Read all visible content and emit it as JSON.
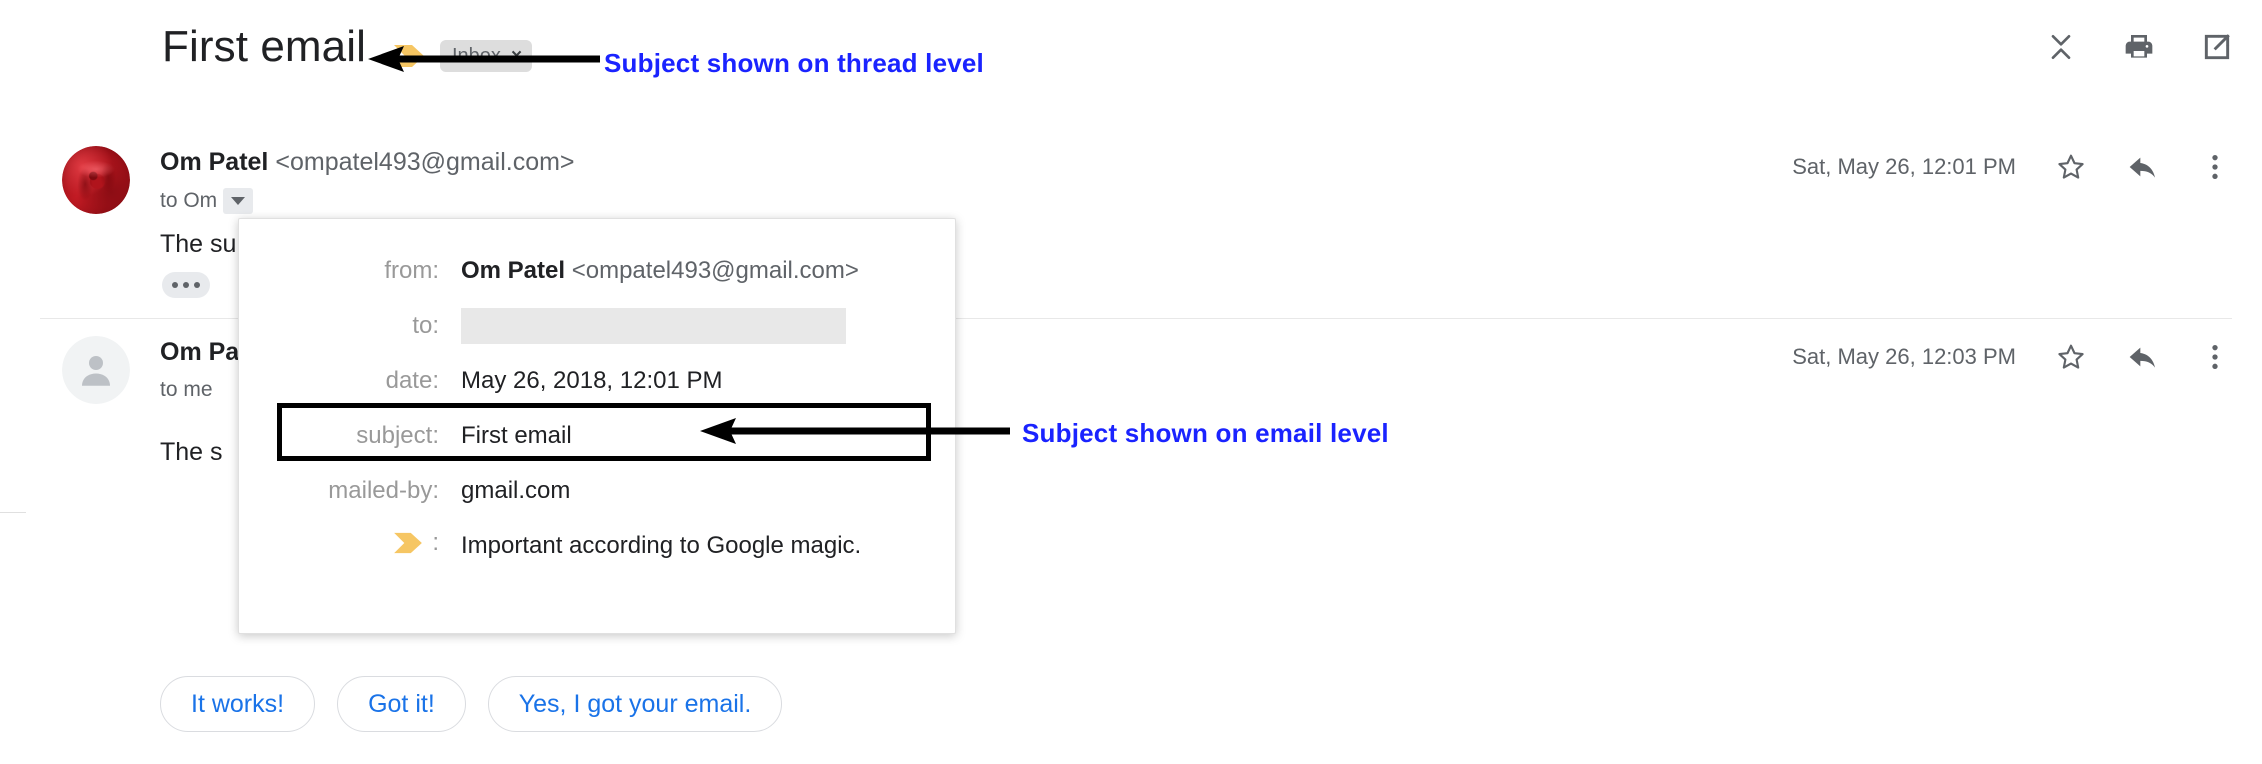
{
  "thread": {
    "subject": "First email",
    "label_chip": {
      "text": "Inbox",
      "remove": "×"
    },
    "importance_icon": "importance-marker-icon",
    "tools": [
      {
        "name": "collapse-all-icon",
        "label": "Collapse all"
      },
      {
        "name": "print-all-icon",
        "label": "Print all"
      },
      {
        "name": "open-in-new-window-icon",
        "label": "Open in new window"
      }
    ]
  },
  "messages": [
    {
      "avatar": "rose-avatar",
      "sender_name": "Om Patel",
      "sender_email": "<ompatel493@gmail.com>",
      "recipient": "to Om",
      "timestamp": "Sat, May 26, 12:01 PM",
      "body": "The su",
      "actions": [
        {
          "name": "star-icon",
          "label": "Star"
        },
        {
          "name": "reply-icon",
          "label": "Reply"
        },
        {
          "name": "more-options-icon",
          "label": "More"
        }
      ]
    },
    {
      "avatar": "generic-person-avatar",
      "sender_name": "Om Pa",
      "sender_email": "",
      "recipient": "to me",
      "timestamp": "Sat, May 26, 12:03 PM",
      "body": "The s",
      "trimmed_content": "•••",
      "actions": [
        {
          "name": "star-icon",
          "label": "Star"
        },
        {
          "name": "reply-icon",
          "label": "Reply"
        },
        {
          "name": "more-options-icon",
          "label": "More"
        }
      ]
    }
  ],
  "details_popup": {
    "rows": [
      {
        "label": "from:",
        "value_strong": "Om Patel",
        "value_muted": "<ompatel493@gmail.com>"
      },
      {
        "label": "to:",
        "value_redacted": true
      },
      {
        "label": "date:",
        "value": "May 26, 2018, 12:01 PM"
      },
      {
        "label": "subject:",
        "value": "First email",
        "highlighted": true
      },
      {
        "label": "mailed-by:",
        "value": "gmail.com"
      },
      {
        "label": "importance:",
        "icon": "importance-marker-icon",
        "colon": ":",
        "value": "Important according to Google magic."
      }
    ]
  },
  "annotations": [
    {
      "text": "Subject shown on thread level",
      "color": "#1a23ff"
    },
    {
      "text": "Subject shown on email level",
      "color": "#1a23ff"
    }
  ],
  "smart_replies": [
    {
      "label": "It works!"
    },
    {
      "label": "Got it!"
    },
    {
      "label": "Yes, I got your email."
    }
  ]
}
